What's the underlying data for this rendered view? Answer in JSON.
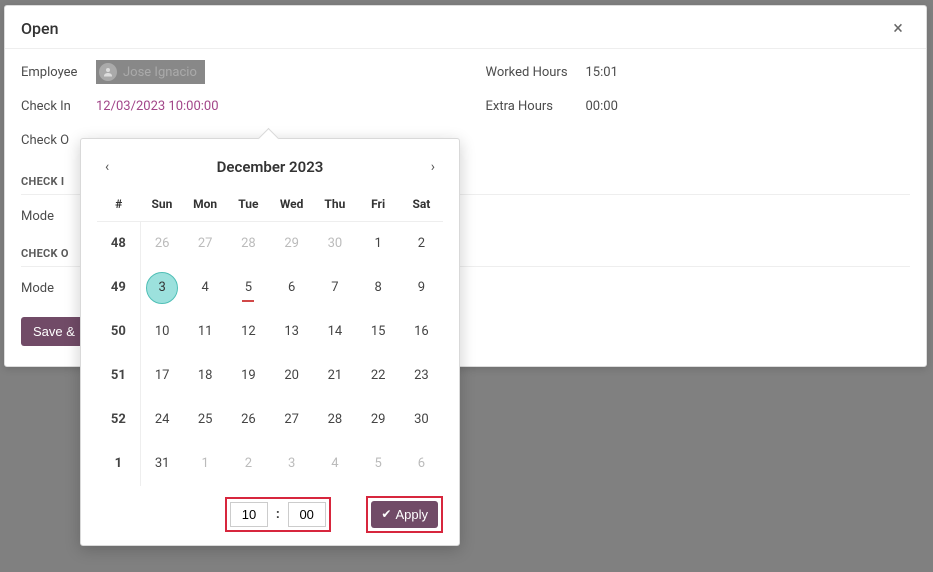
{
  "modal": {
    "title": "Open",
    "close_icon": "×"
  },
  "form": {
    "employee_label": "Employee",
    "employee_name": "Jose Ignacio",
    "checkin_label": "Check In",
    "checkin_value": "12/03/2023 10:00:00",
    "checkout_label": "Check O",
    "worked_hours_label": "Worked Hours",
    "worked_hours_value": "15:01",
    "extra_hours_label": "Extra Hours",
    "extra_hours_value": "00:00",
    "section_checkin": "CHECK I",
    "section_checkout": "CHECK O",
    "mode_label": "Mode",
    "save_label": "Save &"
  },
  "datepicker": {
    "title": "December 2023",
    "prev": "‹",
    "next": "›",
    "week_header": "#",
    "days": [
      "Sun",
      "Mon",
      "Tue",
      "Wed",
      "Thu",
      "Fri",
      "Sat"
    ],
    "rows": [
      {
        "week": "48",
        "cells": [
          {
            "n": "26",
            "other": true
          },
          {
            "n": "27",
            "other": true
          },
          {
            "n": "28",
            "other": true
          },
          {
            "n": "29",
            "other": true
          },
          {
            "n": "30",
            "other": true
          },
          {
            "n": "1"
          },
          {
            "n": "2"
          }
        ]
      },
      {
        "week": "49",
        "cells": [
          {
            "n": "3",
            "selected": true
          },
          {
            "n": "4"
          },
          {
            "n": "5",
            "today": true
          },
          {
            "n": "6"
          },
          {
            "n": "7"
          },
          {
            "n": "8"
          },
          {
            "n": "9"
          }
        ]
      },
      {
        "week": "50",
        "cells": [
          {
            "n": "10"
          },
          {
            "n": "11"
          },
          {
            "n": "12"
          },
          {
            "n": "13"
          },
          {
            "n": "14"
          },
          {
            "n": "15"
          },
          {
            "n": "16"
          }
        ]
      },
      {
        "week": "51",
        "cells": [
          {
            "n": "17"
          },
          {
            "n": "18"
          },
          {
            "n": "19"
          },
          {
            "n": "20"
          },
          {
            "n": "21"
          },
          {
            "n": "22"
          },
          {
            "n": "23"
          }
        ]
      },
      {
        "week": "52",
        "cells": [
          {
            "n": "24"
          },
          {
            "n": "25"
          },
          {
            "n": "26"
          },
          {
            "n": "27"
          },
          {
            "n": "28"
          },
          {
            "n": "29"
          },
          {
            "n": "30"
          }
        ]
      },
      {
        "week": "1",
        "cells": [
          {
            "n": "31"
          },
          {
            "n": "1",
            "other": true
          },
          {
            "n": "2",
            "other": true
          },
          {
            "n": "3",
            "other": true
          },
          {
            "n": "4",
            "other": true
          },
          {
            "n": "5",
            "other": true
          },
          {
            "n": "6",
            "other": true
          }
        ]
      }
    ],
    "time_hour": "10",
    "time_minute": "00",
    "apply_label": "Apply"
  }
}
